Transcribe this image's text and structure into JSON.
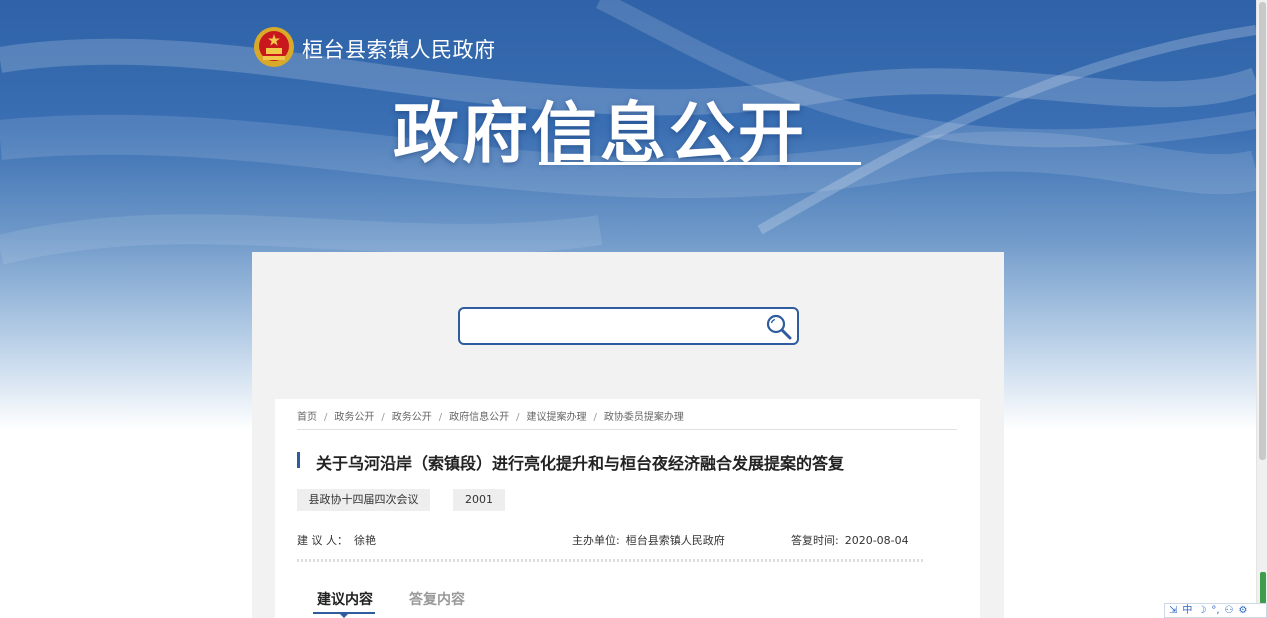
{
  "header": {
    "site_name": "桓台县索镇人民政府",
    "title": "政府信息公开"
  },
  "search": {
    "value": "",
    "placeholder": ""
  },
  "breadcrumb": [
    "首页",
    "政务公开",
    "政务公开",
    "政府信息公开",
    "建议提案办理",
    "政协委员提案办理"
  ],
  "document": {
    "title": "关于乌河沿岸（索镇段）进行亮化提升和与桓台夜经济融合发展提案的答复",
    "tags": [
      "县政协十四届四次会议",
      "2001"
    ],
    "proposer_label": "建 议 人：",
    "proposer": "徐艳",
    "host_unit_label": "主办单位:",
    "host_unit": "桓台县索镇人民政府",
    "reply_time_label": "答复时间:",
    "reply_time": "2020-08-04"
  },
  "tabs": [
    {
      "label": "建议内容",
      "active": true
    },
    {
      "label": "答复内容",
      "active": false
    }
  ],
  "ime_toolbar": {
    "items": [
      "⇲",
      "中",
      "☽",
      "°,",
      "⚇",
      "⚙"
    ]
  },
  "colors": {
    "accent": "#2f5c9e",
    "hero_top": "#2f62a8"
  }
}
